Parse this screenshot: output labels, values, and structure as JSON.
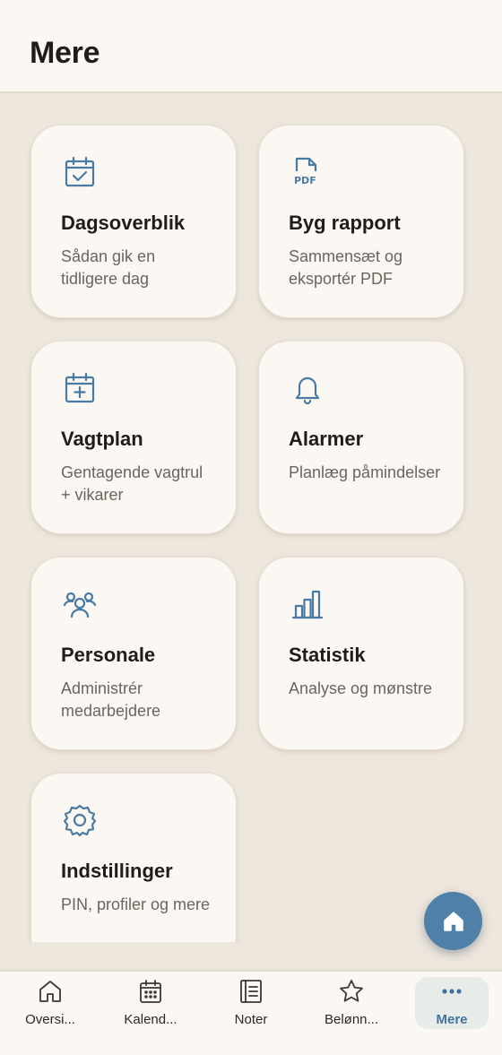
{
  "header": {
    "title": "Mere"
  },
  "cards": [
    {
      "title": "Dagsoverblik",
      "desc": "Sådan gik en tidligere dag",
      "icon": "calendar-check-icon"
    },
    {
      "title": "Byg rapport",
      "desc": "Sammensæt og eksportér PDF",
      "icon": "pdf-file-icon"
    },
    {
      "title": "Vagtplan",
      "desc": "Gentagende vagtrul + vikarer",
      "icon": "calendar-plus-icon"
    },
    {
      "title": "Alarmer",
      "desc": "Planlæg påmindelser",
      "icon": "bell-icon"
    },
    {
      "title": "Personale",
      "desc": "Administrér medarbejdere",
      "icon": "people-icon"
    },
    {
      "title": "Statistik",
      "desc": "Analyse og mønstre",
      "icon": "bar-chart-icon"
    },
    {
      "title": "Indstillinger",
      "desc": "PIN, profiler og mere",
      "icon": "gear-icon"
    }
  ],
  "fab": {
    "icon": "home-icon"
  },
  "tabs": [
    {
      "label": "Oversi...",
      "icon": "home-icon"
    },
    {
      "label": "Kalend...",
      "icon": "calendar-icon"
    },
    {
      "label": "Noter",
      "icon": "notes-icon"
    },
    {
      "label": "Belønn...",
      "icon": "star-icon"
    },
    {
      "label": "Mere",
      "icon": "more-dots-icon",
      "active": true
    }
  ],
  "colors": {
    "accent": "#4f80a8",
    "background": "#ede6dc",
    "surface": "#fbf8f3",
    "text": "#1f1d1a",
    "muted_text": "#6a655e"
  }
}
